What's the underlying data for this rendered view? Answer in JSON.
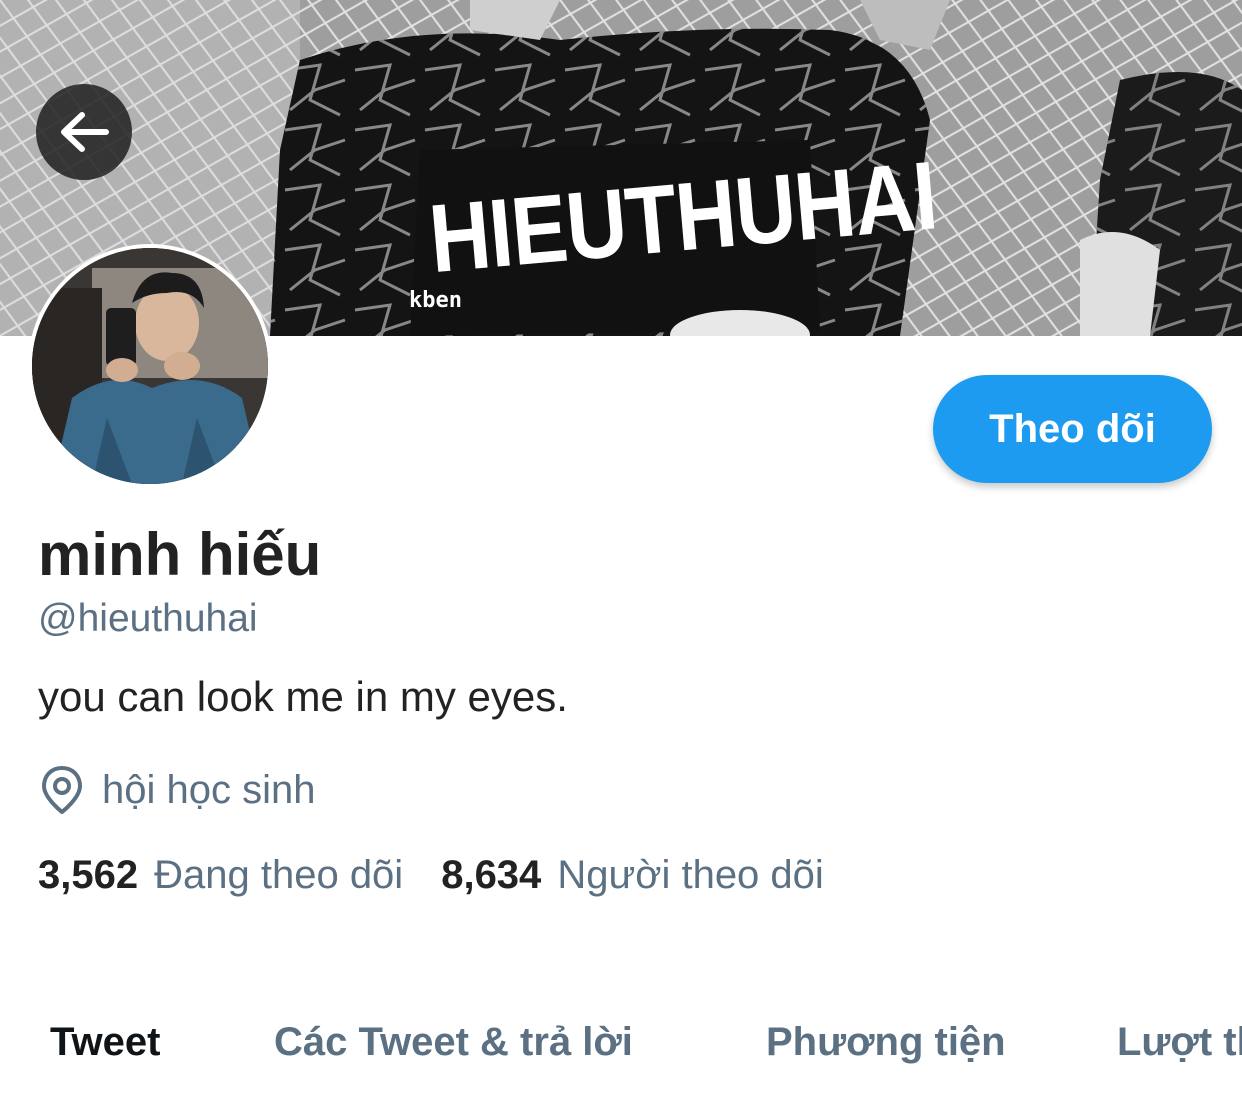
{
  "banner": {
    "jersey_text": "HIEUTHUHAI",
    "brand_text": "kben"
  },
  "back_button": {
    "icon": "arrow-left-icon"
  },
  "profile": {
    "display_name": "minh hiếu",
    "handle": "@hieuthuhai",
    "bio": "you can look me in my eyes.",
    "location": {
      "icon": "location-pin-icon",
      "text": "hội học sinh"
    }
  },
  "follow_button": {
    "label": "Theo dõi",
    "color": "#1d9bf0"
  },
  "stats": {
    "following": {
      "count": "3,562",
      "label": "Đang theo dõi"
    },
    "followers": {
      "count": "8,634",
      "label": "Người theo dõi"
    }
  },
  "tabs": [
    {
      "label": "Tweet",
      "active": true
    },
    {
      "label": "Các Tweet & trả lời",
      "active": false
    },
    {
      "label": "Phương tiện",
      "active": false
    },
    {
      "label": "Lượt thích",
      "active": false
    }
  ],
  "colors": {
    "accent": "#1d9bf0",
    "secondary_text": "#5b7083",
    "primary_text": "#222222"
  }
}
